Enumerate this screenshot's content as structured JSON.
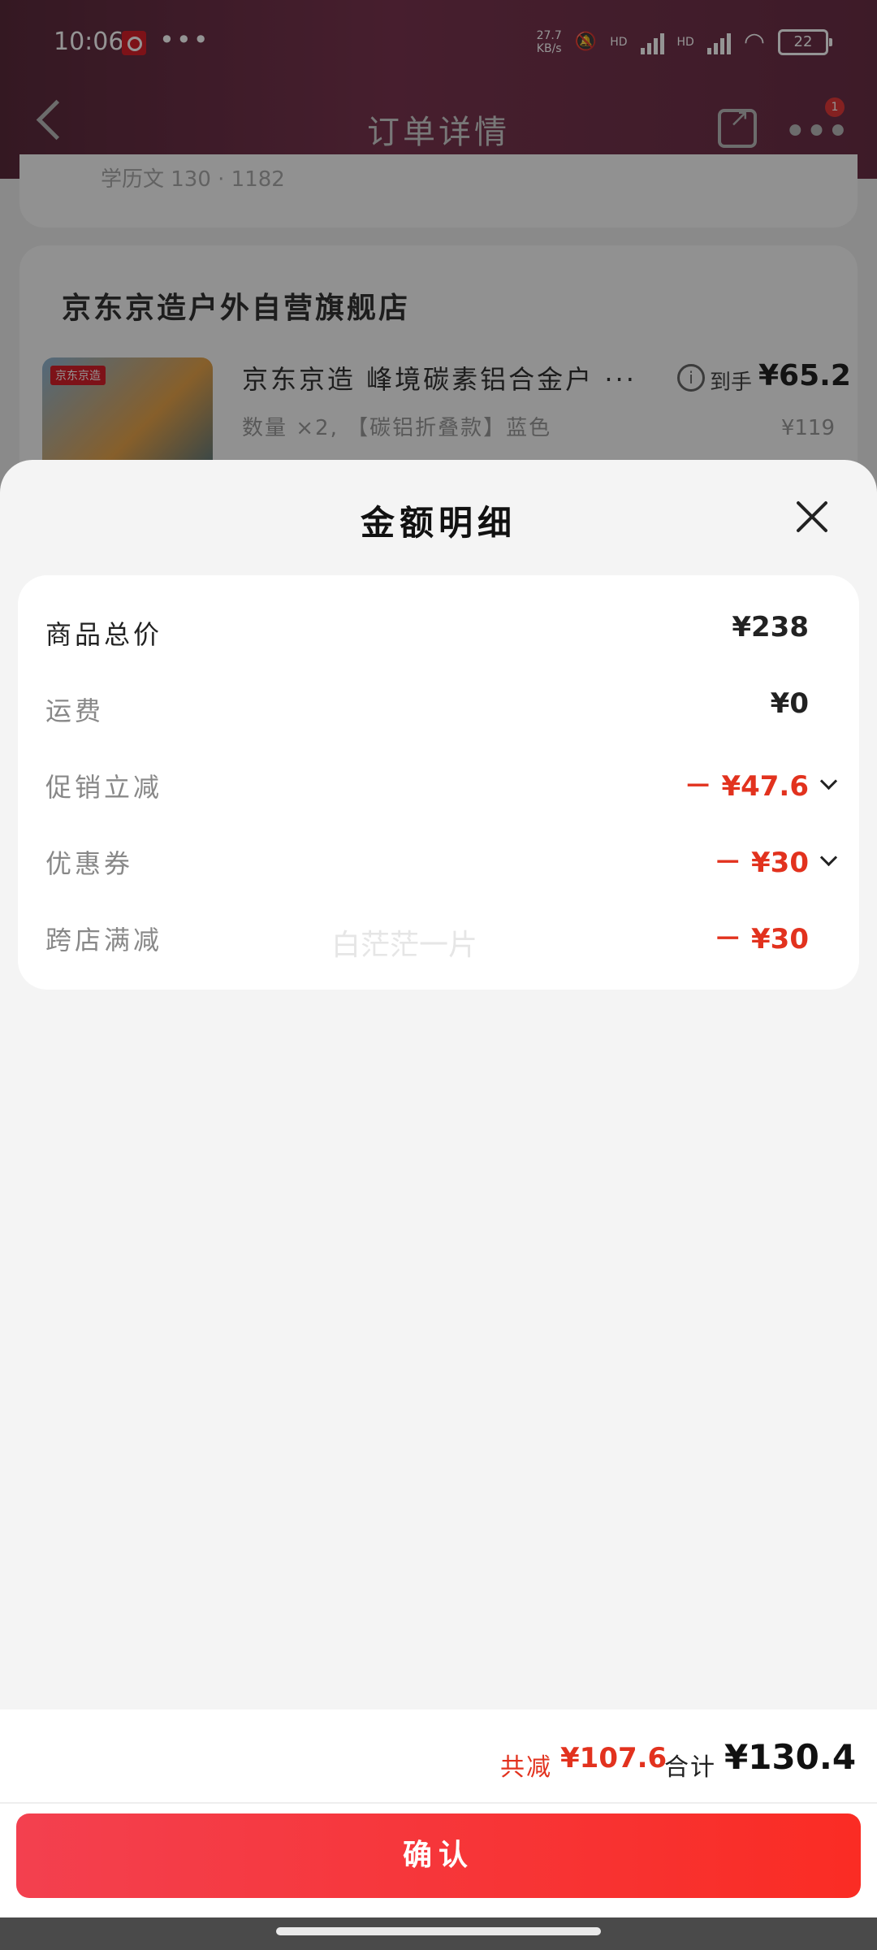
{
  "status_bar": {
    "time": "10:06",
    "dots": "•••",
    "net_speed": "27.7\nKB/s",
    "hd1": "HD",
    "hd2": "HD",
    "battery": "22"
  },
  "nav": {
    "title": "订单详情",
    "badge": "1"
  },
  "background_order": {
    "prev_line": "学历文 130 · 1182",
    "store_name": "京东京造户外自营旗舰店",
    "product_image_label": "京东京造",
    "product_title": "京东京造 峰境碳素铝合金户 ···",
    "product_spec": "数量 ×2, 【碳铝折叠款】蓝色",
    "arrive_label": "到手",
    "arrive_price": "¥65.2",
    "original_price": "¥119"
  },
  "sheet": {
    "title": "金额明细",
    "rows": [
      {
        "label": "商品总价",
        "value": "¥238"
      },
      {
        "label": "运费",
        "value": "¥0"
      },
      {
        "label": "促销立减",
        "value": "－ ¥47.6"
      },
      {
        "label": "优惠券",
        "value": "－ ¥30"
      },
      {
        "label": "跨店满减",
        "value": "－ ¥30"
      }
    ],
    "watermark": "白茫茫一片"
  },
  "footer": {
    "save_label": "共减",
    "save_amount": "¥107.6",
    "total_label": "合计",
    "total_amount": "¥130.4",
    "confirm_label": "确认"
  },
  "colors": {
    "accent_red": "#e2321e",
    "button_gradient_start": "#f3404f",
    "button_gradient_end": "#fa2c24"
  }
}
